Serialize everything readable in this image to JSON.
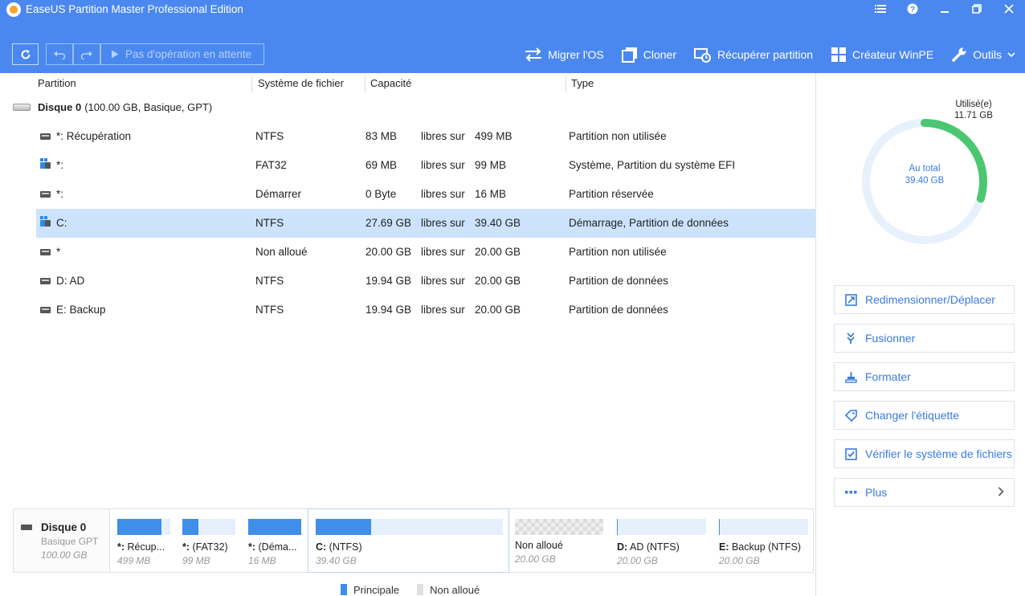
{
  "window": {
    "title": "EaseUS Partition Master Professional Edition"
  },
  "toolbar": {
    "pending_label": "Pas d'opération en attente",
    "items": [
      {
        "label": "Migrer l'OS",
        "icon": "migrate-icon"
      },
      {
        "label": "Cloner",
        "icon": "clone-icon"
      },
      {
        "label": "Récupérer partition",
        "icon": "recover-icon"
      },
      {
        "label": "Créateur WinPE",
        "icon": "windows-icon"
      },
      {
        "label": "Outils",
        "icon": "wrench-icon"
      }
    ]
  },
  "table": {
    "columns": [
      "Partition",
      "Système de fichier",
      "Capacité",
      "Type"
    ],
    "disk": {
      "name": "Disque 0",
      "detail": "(100.00 GB, Basique, GPT)"
    },
    "rows": [
      {
        "name": "*: Récupération",
        "fs": "NTFS",
        "free": "83 MB",
        "sep": "libres sur",
        "total": "499 MB",
        "type": "Partition non utilisée",
        "icon": "drive-icon"
      },
      {
        "name": "*:",
        "fs": "FAT32",
        "free": "69 MB",
        "sep": "libres sur",
        "total": "99 MB",
        "type": "Système, Partition du système EFI",
        "icon": "system-drive-icon"
      },
      {
        "name": "*:",
        "fs": "Démarrer",
        "free": "0 Byte",
        "sep": "libres sur",
        "total": "16 MB",
        "type": "Partition réservée",
        "icon": "drive-icon"
      },
      {
        "name": "C:",
        "fs": "NTFS",
        "free": "27.69 GB",
        "sep": "libres sur",
        "total": "39.40 GB",
        "type": "Démarrage, Partition de données",
        "icon": "system-drive-icon",
        "selected": true
      },
      {
        "name": "*",
        "fs": "Non alloué",
        "free": "20.00 GB",
        "sep": "libres sur",
        "total": "20.00 GB",
        "type": "Partition non utilisée",
        "icon": "drive-icon"
      },
      {
        "name": "D: AD",
        "fs": "NTFS",
        "free": "19.94 GB",
        "sep": "libres sur",
        "total": "20.00 GB",
        "type": "Partition de données",
        "icon": "drive-icon"
      },
      {
        "name": "E: Backup",
        "fs": "NTFS",
        "free": "19.94 GB",
        "sep": "libres sur",
        "total": "20.00 GB",
        "type": "Partition de données",
        "icon": "drive-icon"
      }
    ]
  },
  "usage": {
    "used_label": "Utilisé(e)",
    "used_value": "11.71 GB",
    "total_label": "Au total",
    "total_value": "39.40 GB",
    "used_fraction": 0.297,
    "used_color": "#4cc771",
    "track_color": "#e6f1fc"
  },
  "actions": [
    {
      "label": "Redimensionner/Déplacer",
      "icon": "resize-icon"
    },
    {
      "label": "Fusionner",
      "icon": "merge-icon"
    },
    {
      "label": "Formater",
      "icon": "format-icon"
    },
    {
      "label": "Changer l'étiquette",
      "icon": "tag-icon"
    },
    {
      "label": "Vérifier le système de fichiers",
      "icon": "check-icon"
    },
    {
      "label": "Plus",
      "icon": "more-icon"
    }
  ],
  "diskmap": {
    "disk_name": "Disque 0",
    "disk_type": "Basique GPT",
    "disk_size": "100.00 GB",
    "segments": [
      {
        "label_bold": "*:",
        "label": " Récup...",
        "size": "499 MB",
        "used": 0.83
      },
      {
        "label_bold": "*:",
        "label": " (FAT32)",
        "size": "99 MB",
        "used": 0.3
      },
      {
        "label_bold": "*:",
        "label": " (Déma...",
        "size": "16 MB",
        "used": 1.0
      },
      {
        "label_bold": "C:",
        "label": " (NTFS)",
        "size": "39.40 GB",
        "used": 0.297,
        "selected": true
      },
      {
        "label_bold": "",
        "label": "Non alloué",
        "size": "20.00 GB",
        "used": 0,
        "unallocated": true
      },
      {
        "label_bold": "D:",
        "label": " AD (NTFS)",
        "size": "20.00 GB",
        "used": 0.003
      },
      {
        "label_bold": "E:",
        "label": " Backup (NTFS)",
        "size": "20.00 GB",
        "used": 0.003
      }
    ]
  },
  "legend": [
    {
      "label": "Principale",
      "color": "#3f8ee8"
    },
    {
      "label": "Non alloué",
      "color": "#e0e0e0"
    }
  ]
}
